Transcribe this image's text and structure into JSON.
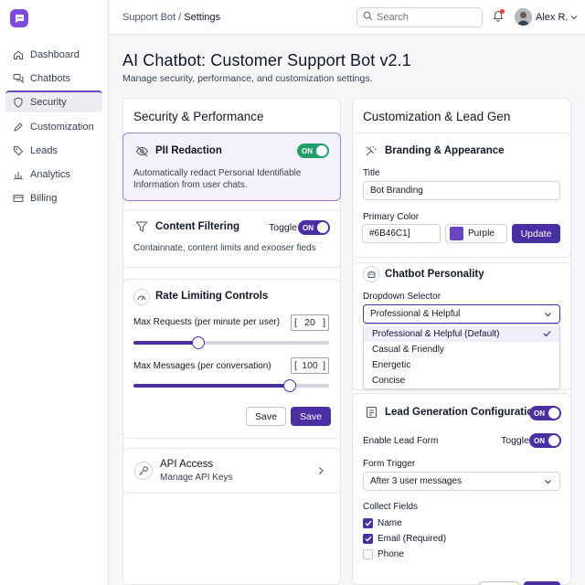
{
  "breadcrumb": {
    "parent": "Support Bot",
    "separator": " / ",
    "current": "Settings"
  },
  "search": {
    "placeholder": "Search"
  },
  "user": {
    "name": "Alex R."
  },
  "sidebar": {
    "items": [
      {
        "label": "Dashboard",
        "icon": "home-icon"
      },
      {
        "label": "Chatbots",
        "icon": "chat-icon"
      },
      {
        "label": "Security",
        "icon": "shield-icon",
        "active": true
      },
      {
        "label": "Customization",
        "icon": "pencil-icon"
      },
      {
        "label": "Leads",
        "icon": "tag-icon"
      },
      {
        "label": "Analytics",
        "icon": "bar-chart-icon"
      },
      {
        "label": "Billing",
        "icon": "credit-card-icon"
      }
    ]
  },
  "page": {
    "title": "AI Chatbot: Customer Support Bot v2.1",
    "subtitle": "Manage security, performance, and customization settings."
  },
  "security": {
    "title": "Security & Performance",
    "pii": {
      "title": "PII Redaction",
      "toggle": "ON",
      "description_line1": "Automatically redact Personal Identifiable",
      "description_line2": "Information from user chats."
    },
    "content_filter": {
      "title": "Content Filtering",
      "toggle_word": "Toggle",
      "toggle": "ON",
      "description": "Containnate, content limits and exooser fieds"
    },
    "rate_limit": {
      "title": "Rate Limiting Controls",
      "requests_label": "Max Requests (per minute per user)",
      "requests_value": "20",
      "requests_slider_fraction": 0.33,
      "messages_label": "Max Messages (per conversation)",
      "messages_value": "100",
      "messages_slider_fraction": 0.8,
      "bracket_open": "[",
      "bracket_close": "]",
      "save_outline": "Save",
      "save_primary": "Save"
    },
    "api": {
      "title": "API Access",
      "subtitle": "Manage API Keys"
    }
  },
  "customization": {
    "title": "Customization & Lead Gen",
    "branding": {
      "title": "Branding & Appearance",
      "title_label": "Title",
      "title_value": "Bot Branding",
      "color_label": "Primary Color",
      "color_value": "#6B46C1]",
      "color_name": "Purple",
      "swatch_color": "#6B46C1",
      "update_button": "Update"
    },
    "personality": {
      "title": "Chatbot Personality",
      "dropdown_label": "Dropdown Selector",
      "selected": "Professional & Helpful",
      "options": [
        "Professional & Helpful (Default)",
        "Casual & Friendly",
        "Energetic",
        "Concise"
      ]
    },
    "lead_gen": {
      "title": "Lead Generation Configuration",
      "toggle": "ON",
      "enable_label": "Enable Lead Form",
      "toggle_word": "Toggle",
      "enable_toggle": "ON",
      "trigger_label": "Form Trigger",
      "trigger_value": "After 3 user messages",
      "collect_label": "Collect Fields",
      "fields": [
        {
          "label": "Name",
          "checked": true
        },
        {
          "label": "Email (Required)",
          "checked": true
        },
        {
          "label": "Phone",
          "checked": false
        }
      ]
    }
  },
  "colors": {
    "accent": "#4A2FA3",
    "brand": "#7C4DDB",
    "success": "#22A06B"
  }
}
